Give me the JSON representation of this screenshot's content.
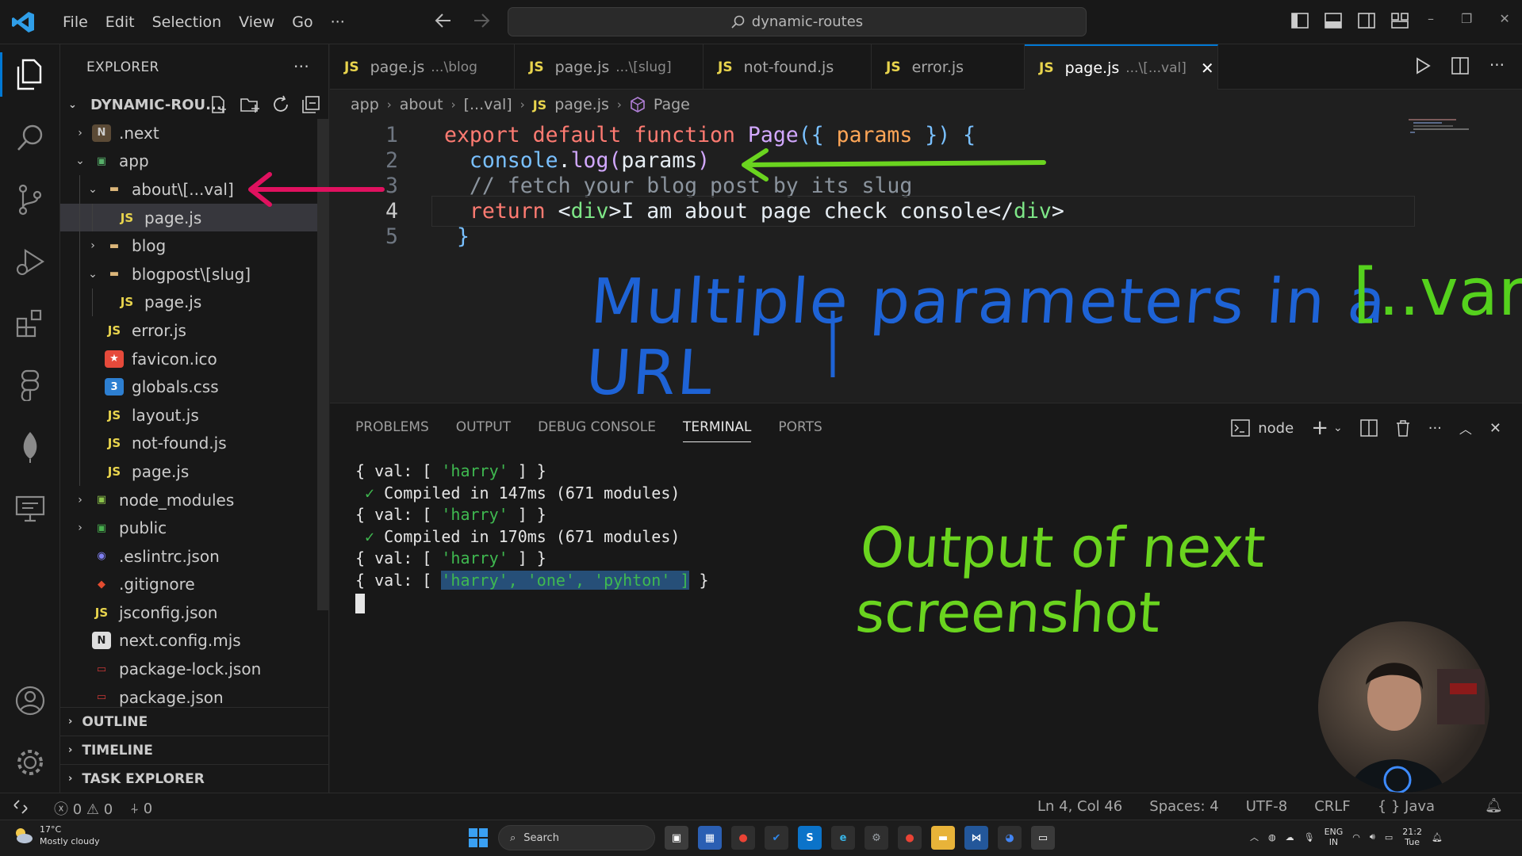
{
  "titlebar": {
    "menu": [
      "File",
      "Edit",
      "Selection",
      "View",
      "Go",
      "···"
    ],
    "search_text": "dynamic-routes"
  },
  "activity_icons": [
    "explorer-icon",
    "search-icon",
    "source-control-icon",
    "run-debug-icon",
    "extensions-icon",
    "figma-icon",
    "mongodb-icon",
    "remote-explorer-icon",
    "account-icon",
    "settings-gear-icon"
  ],
  "sidebar": {
    "title": "EXPLORER",
    "root": "DYNAMIC-ROU...",
    "tree": [
      {
        "label": ".next",
        "depth": 1,
        "chev": "›",
        "icon": "folder-next"
      },
      {
        "label": "app",
        "depth": 1,
        "chev": "⌄",
        "icon": "folder-app"
      },
      {
        "label": "about\\[...val]",
        "depth": 2,
        "chev": "⌄",
        "icon": "folder"
      },
      {
        "label": "page.js",
        "depth": 3,
        "chev": "",
        "icon": "js",
        "selected": true
      },
      {
        "label": "blog",
        "depth": 2,
        "chev": "›",
        "icon": "folder"
      },
      {
        "label": "blogpost\\[slug]",
        "depth": 2,
        "chev": "⌄",
        "icon": "folder"
      },
      {
        "label": "page.js",
        "depth": 3,
        "chev": "",
        "icon": "js"
      },
      {
        "label": "error.js",
        "depth": 2,
        "chev": "",
        "icon": "js"
      },
      {
        "label": "favicon.ico",
        "depth": 2,
        "chev": "",
        "icon": "favicon"
      },
      {
        "label": "globals.css",
        "depth": 2,
        "chev": "",
        "icon": "css"
      },
      {
        "label": "layout.js",
        "depth": 2,
        "chev": "",
        "icon": "js"
      },
      {
        "label": "not-found.js",
        "depth": 2,
        "chev": "",
        "icon": "js"
      },
      {
        "label": "page.js",
        "depth": 2,
        "chev": "",
        "icon": "js"
      },
      {
        "label": "node_modules",
        "depth": 1,
        "chev": "›",
        "icon": "folder-node"
      },
      {
        "label": "public",
        "depth": 1,
        "chev": "›",
        "icon": "folder-public"
      },
      {
        "label": ".eslintrc.json",
        "depth": 1,
        "chev": "",
        "icon": "eslint"
      },
      {
        "label": ".gitignore",
        "depth": 1,
        "chev": "",
        "icon": "git"
      },
      {
        "label": "jsconfig.json",
        "depth": 1,
        "chev": "",
        "icon": "jsconfig"
      },
      {
        "label": "next.config.mjs",
        "depth": 1,
        "chev": "",
        "icon": "next"
      },
      {
        "label": "package-lock.json",
        "depth": 1,
        "chev": "",
        "icon": "npm"
      },
      {
        "label": "package.json",
        "depth": 1,
        "chev": "",
        "icon": "npm"
      }
    ],
    "sections": [
      "OUTLINE",
      "TIMELINE",
      "TASK EXPLORER"
    ]
  },
  "tabs": [
    {
      "label": "page.js",
      "desc": "...\\blog",
      "active": false
    },
    {
      "label": "page.js",
      "desc": "...\\[slug]",
      "active": false
    },
    {
      "label": "not-found.js",
      "desc": "",
      "active": false
    },
    {
      "label": "error.js",
      "desc": "",
      "active": false
    },
    {
      "label": "page.js",
      "desc": "...\\[...val]",
      "active": true
    }
  ],
  "breadcrumb": [
    "app",
    "about",
    "[...val]",
    "page.js",
    "Page"
  ],
  "code": {
    "line_numbers": [
      "1",
      "2",
      "3",
      "4",
      "5"
    ],
    "current_line": 4
  },
  "annotations": {
    "blue_note": "Multiple parameters in a URL",
    "bracket_note": "[..var]",
    "green_note": "Output of next screenshot"
  },
  "panel": {
    "tabs": [
      "PROBLEMS",
      "OUTPUT",
      "DEBUG CONSOLE",
      "TERMINAL",
      "PORTS"
    ],
    "active_tab": "TERMINAL",
    "terminal_name": "node",
    "lines": [
      {
        "pre": "{ val: [ ",
        "str": "'harry'",
        "post": " ] }"
      },
      {
        "check": "✓",
        "text": " Compiled in 147ms (671 modules)"
      },
      {
        "pre": "{ val: [ ",
        "str": "'harry'",
        "post": " ] }"
      },
      {
        "check": "✓",
        "text": " Compiled in 170ms (671 modules)"
      },
      {
        "pre": "{ val: [ ",
        "str": "'harry'",
        "post": " ] }"
      },
      {
        "pre": "{ val: [ ",
        "hl": "'harry', 'one', 'pyhton' ]",
        "post": " }"
      }
    ]
  },
  "statusbar": {
    "errors": "0",
    "warnings": "0",
    "ports": "0",
    "position": "Ln 4, Col 46",
    "spaces": "Spaces: 4",
    "encoding": "UTF-8",
    "eol": "CRLF",
    "language": "{ } Java"
  },
  "taskbar": {
    "temperature": "17°C",
    "weather": "Mostly cloudy",
    "search": "Search",
    "lang_top": "ENG",
    "lang_bottom": "IN",
    "time": "21:2",
    "day": "Tue"
  },
  "colors": {
    "accent": "#0078d4",
    "annotation_blue": "#1e63d6",
    "annotation_green": "#55d11d",
    "arrow_red": "#e0115f"
  }
}
